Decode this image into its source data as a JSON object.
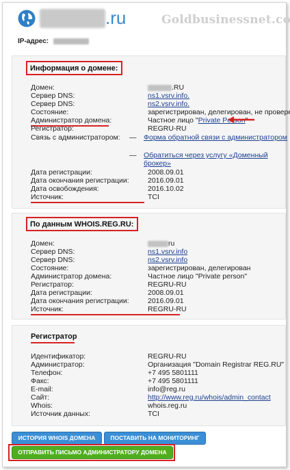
{
  "header": {
    "domain_tld": ".ru",
    "watermark": "Goldbusinessnet.com",
    "ip_label": "IP-адрес:"
  },
  "domain_info": {
    "title": "Информация о домене:",
    "rows": [
      {
        "label": "Домен:",
        "value": ".RU"
      },
      {
        "label": "Сервер DNS:",
        "value": "ns1.vsrv.info."
      },
      {
        "label": "Сервер DNS:",
        "value": "ns2.vsrv.info."
      },
      {
        "label": "Состояние:",
        "value": "зарегистрирован, делегирован, не проверен"
      },
      {
        "label": "Администратор домена:",
        "value_prefix": "Частное лицо \"",
        "value_link": "Private Person",
        "value_suffix": "\""
      },
      {
        "label": "Регистратор:",
        "value": "REGRU-RU"
      },
      {
        "label": "Связь с администратором:",
        "contact_link_1": "Форма обратной связи с администратором",
        "contact_link_2a": "Обратиться через услугу «Доменный",
        "contact_link_2b": "брокер»"
      },
      {
        "label": "Дата регистрации:",
        "value": "2008.09.01"
      },
      {
        "label": "Дата окончания регистрации:",
        "value": "2016.09.01"
      },
      {
        "label": "Дата освобождения:",
        "value": "2016.10.02"
      },
      {
        "label": "Источник:",
        "value": "TCI"
      }
    ],
    "dash": "—"
  },
  "whois_reg": {
    "title": "По данным WHOIS.REG.RU:",
    "rows": [
      {
        "label": "Домен:",
        "value": "ru"
      },
      {
        "label": "Сервер DNS:",
        "value": "ns1.vsrv.info"
      },
      {
        "label": "Сервер DNS:",
        "value": "ns2.vsrv.info"
      },
      {
        "label": "Состояние:",
        "value": "зарегистрирован, делегирован"
      },
      {
        "label": "Администратор домена:",
        "value": "Частное лицо \"Private person\""
      },
      {
        "label": "Регистратор:",
        "value": "REGRU-RU"
      },
      {
        "label": "Дата регистрации:",
        "value": "2008.09.01"
      },
      {
        "label": "Дата окончания регистрации:",
        "value": "2016.09.01"
      },
      {
        "label": "Источник:",
        "value": "REGRU-RU"
      }
    ]
  },
  "registrar": {
    "title": "Регистратор",
    "rows": [
      {
        "label": "Идентификатор:",
        "value": "REGRU-RU"
      },
      {
        "label": "Администратор:",
        "value": "Организация \"Domain Registrar REG.RU\""
      },
      {
        "label": "Телефон:",
        "value": "+7 495 5801111"
      },
      {
        "label": "Факс:",
        "value": "+7 495 5801111"
      },
      {
        "label": "E-mail:",
        "value": "info@reg.ru"
      },
      {
        "label": "Сайт:",
        "value": "http://www.reg.ru/whois/admin_contact"
      },
      {
        "label": "Whois:",
        "value": "whois.reg.ru"
      },
      {
        "label": "Источник данных:",
        "value": "TCI"
      }
    ]
  },
  "buttons": {
    "history": "ИСТОРИЯ WHOIS ДОМЕНА",
    "monitor": "ПОСТАВИТЬ НА МОНИТОРИНГ",
    "send": "ОТПРАВИТЬ ПИСЬМО АДМИНИСТРАТОРУ ДОМЕНА"
  },
  "colors": {
    "accent_blue": "#3a87c9",
    "annotation_red": "#d82020",
    "button_blue": "#3a8fd6",
    "button_green": "#4fae1f"
  }
}
